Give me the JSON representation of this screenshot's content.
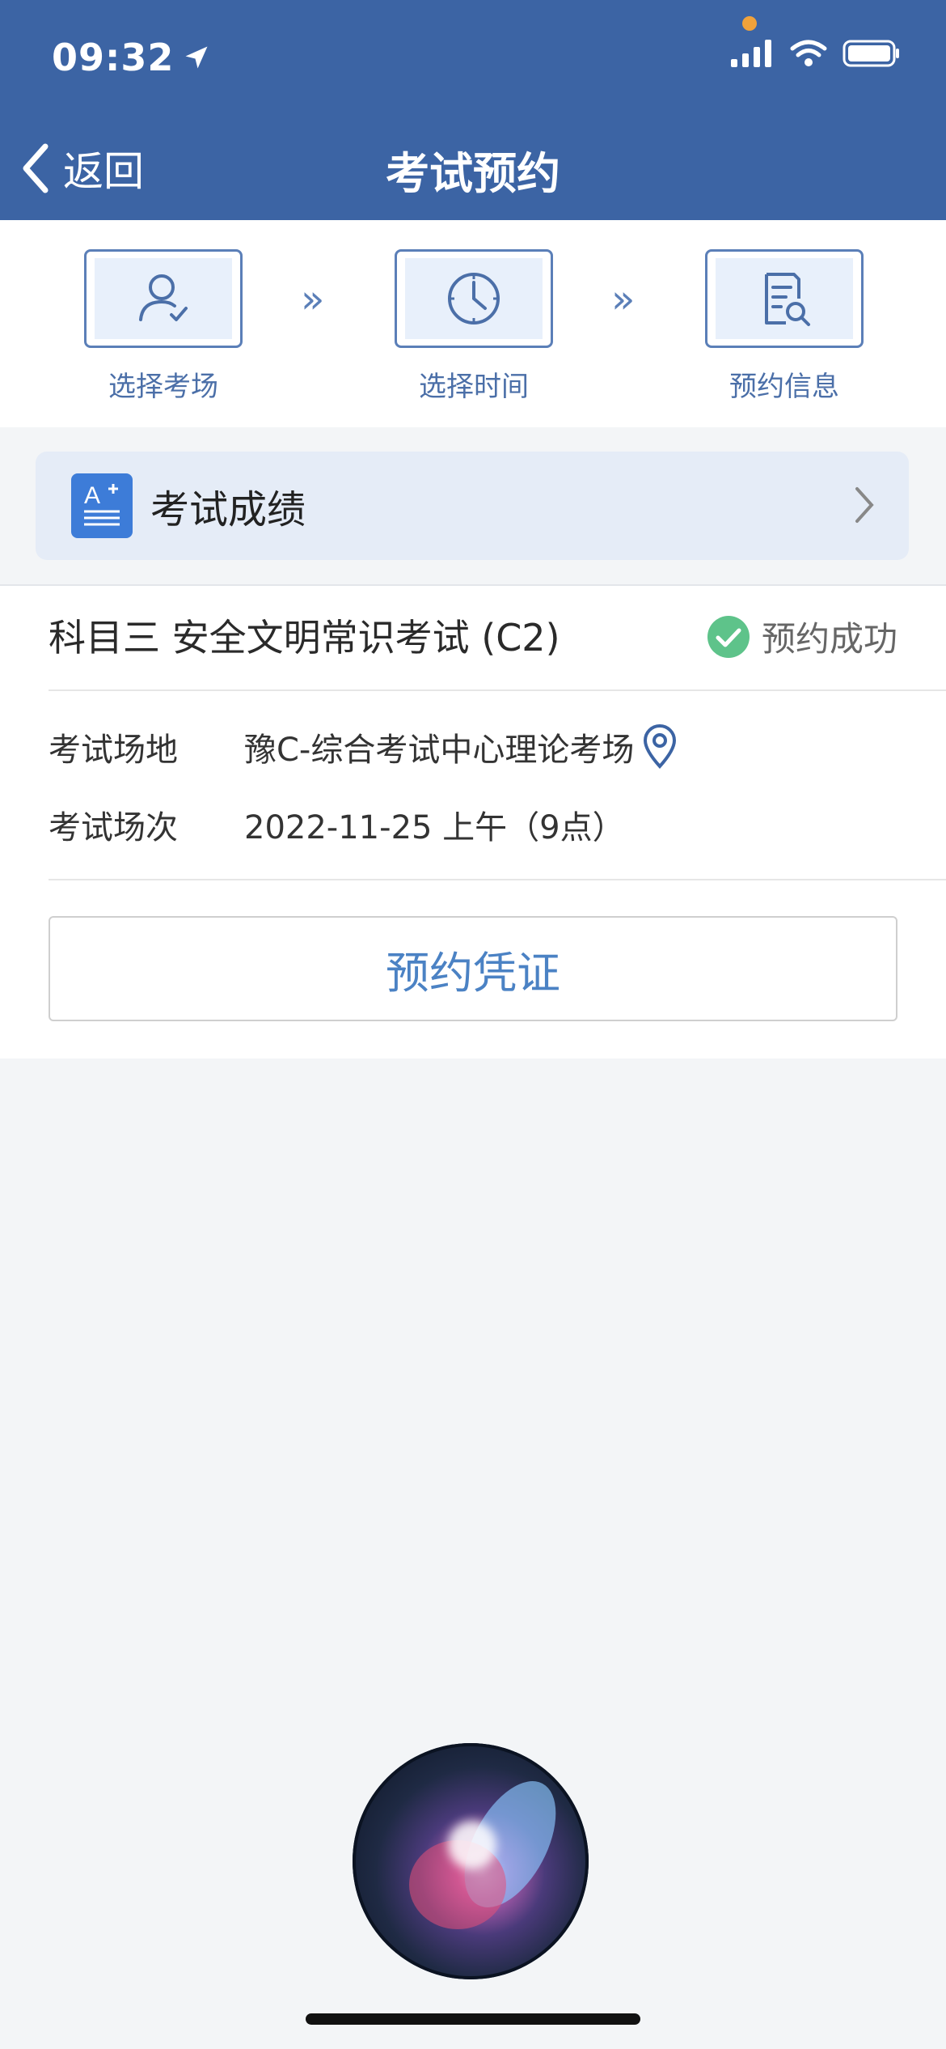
{
  "status_bar": {
    "time": "09:32"
  },
  "nav": {
    "back_label": "返回",
    "title": "考试预约"
  },
  "steps": [
    {
      "label": "选择考场",
      "icon": "person-check-icon"
    },
    {
      "label": "选择时间",
      "icon": "clock-icon"
    },
    {
      "label": "预约信息",
      "icon": "document-search-icon"
    }
  ],
  "score_entry": {
    "label": "考试成绩",
    "icon": "grade-icon"
  },
  "appointment": {
    "subject": "科目三 安全文明常识考试 (C2)",
    "status": "预约成功",
    "venue_label": "考试场地",
    "venue_value": "豫C-综合考试中心理论考场",
    "session_label": "考试场次",
    "session_value": "2022-11-25 上午（9点）",
    "voucher_button": "预约凭证"
  },
  "colors": {
    "header": "#3c64a4",
    "accent": "#4b82c4",
    "success": "#5ec38a"
  }
}
